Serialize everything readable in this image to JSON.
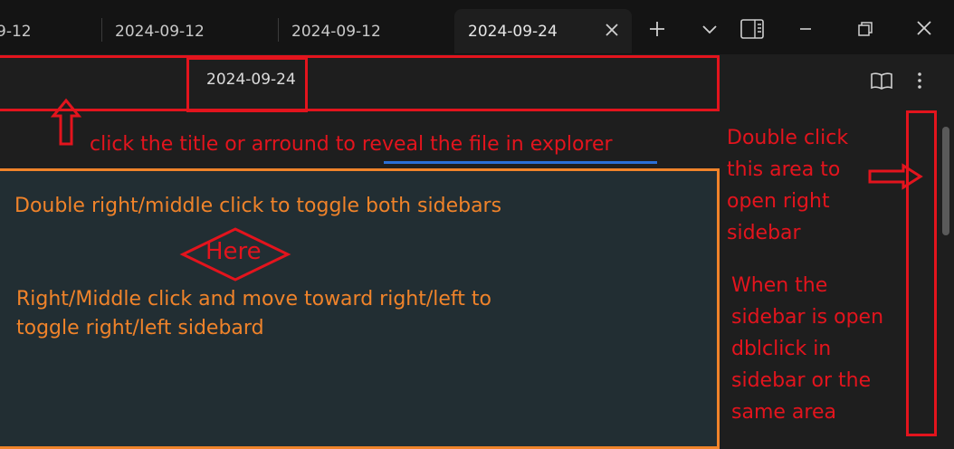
{
  "tabs": [
    {
      "label": "9-12",
      "active": false
    },
    {
      "label": "2024-09-12",
      "active": false
    },
    {
      "label": "2024-09-12",
      "active": false
    },
    {
      "label": "2024-09-24",
      "active": true
    }
  ],
  "toolbar_icons": [
    "plus-icon",
    "chevron-down-icon",
    "reading-pane-icon",
    "minimize-icon",
    "restore-icon",
    "close-icon"
  ],
  "view_header": {
    "title": "2024-09-24",
    "icons": [
      "book-open-icon",
      "more-options-icon"
    ]
  },
  "annotations": {
    "title_hint_prefix": "click the title or arround to ",
    "title_hint_link": "reveal the file in explorer",
    "right_hint_lines": [
      "Double click",
      "this area to",
      "open right",
      "sidebar"
    ],
    "right_hint2_lines": [
      "When the",
      "sidebar is open",
      "dblclick in",
      "sidebar or the",
      "same area"
    ],
    "toggle_both": "Double right/middle click to toggle both sidebars",
    "here": "Here",
    "drag_hint_lines": [
      "Right/Middle click and move toward right/left to",
      "toggle right/left sidebard"
    ]
  },
  "colors": {
    "annotation_red": "#e3141d",
    "annotation_orange": "#f0832a",
    "link_underline": "#2a6fd6",
    "background": "#1e1e1e",
    "tabbar": "#141414"
  }
}
